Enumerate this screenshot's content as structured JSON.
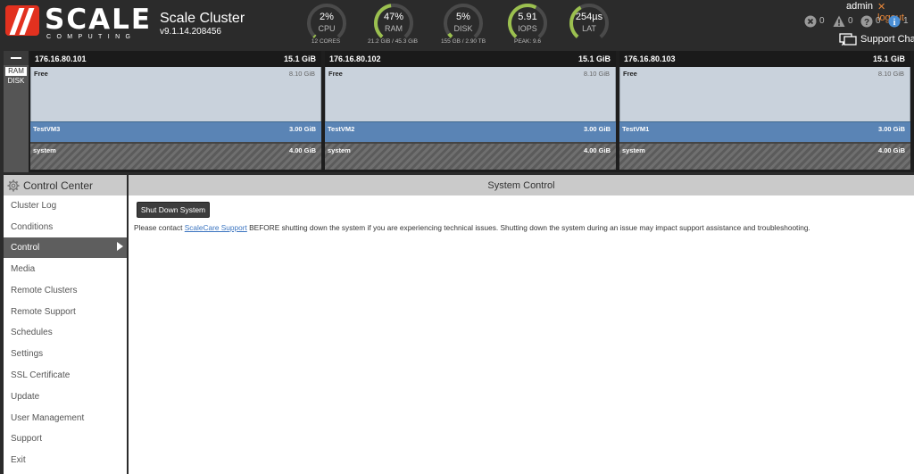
{
  "header": {
    "logo_text": "SCALE",
    "logo_subtext": "COMPUTING",
    "cluster_name": "Scale Cluster",
    "version": "v9.1.14.208456"
  },
  "gauges": [
    {
      "value": "2%",
      "label": "CPU",
      "sub": "12 CORES",
      "level": 0.02
    },
    {
      "value": "47%",
      "label": "RAM",
      "sub": "21.2 GiB / 45.3 GiB",
      "level": 0.47
    },
    {
      "value": "5%",
      "label": "DISK",
      "sub": "155 GB / 2.90 TB",
      "level": 0.05
    },
    {
      "value": "5.91",
      "label": "IOPS",
      "sub": "PEAK: 9.6",
      "level": 0.6
    },
    {
      "value": "254µs",
      "label": "LAT",
      "sub": "",
      "level": 0.4
    }
  ],
  "user": {
    "name": "admin",
    "logout_label": "logout"
  },
  "alerts": [
    {
      "icon": "error-icon",
      "count": "0"
    },
    {
      "icon": "warning-icon",
      "count": "0"
    },
    {
      "icon": "question-icon",
      "count": "0"
    },
    {
      "icon": "info-icon",
      "count": "1"
    }
  ],
  "support_chat_label": "Support Chat",
  "resource_toggle": {
    "ram": "RAM",
    "disk": "DISK"
  },
  "nodes": [
    {
      "ip": "176.16.80.101",
      "total": "15.1 GiB",
      "free_label": "Free",
      "free_size": "8.10 GiB",
      "vm_label": "TestVM3",
      "vm_size": "3.00 GiB",
      "system_label": "system",
      "system_size": "4.00 GiB"
    },
    {
      "ip": "176.16.80.102",
      "total": "15.1 GiB",
      "free_label": "Free",
      "free_size": "8.10 GiB",
      "vm_label": "TestVM2",
      "vm_size": "3.00 GiB",
      "system_label": "system",
      "system_size": "4.00 GiB"
    },
    {
      "ip": "176.16.80.103",
      "total": "15.1 GiB",
      "free_label": "Free",
      "free_size": "8.10 GiB",
      "vm_label": "TestVM1",
      "vm_size": "3.00 GiB",
      "system_label": "system",
      "system_size": "4.00 GiB"
    }
  ],
  "sidebar": {
    "title": "Control Center",
    "items": [
      {
        "label": "Cluster Log"
      },
      {
        "label": "Conditions"
      },
      {
        "label": "Control",
        "active": true
      },
      {
        "label": "Media"
      },
      {
        "label": "Remote Clusters"
      },
      {
        "label": "Remote Support"
      },
      {
        "label": "Schedules"
      },
      {
        "label": "Settings"
      },
      {
        "label": "SSL Certificate"
      },
      {
        "label": "Update"
      },
      {
        "label": "User Management"
      },
      {
        "label": "Support"
      },
      {
        "label": "Exit"
      }
    ]
  },
  "main": {
    "title": "System Control",
    "shutdown_label": "Shut Down System",
    "notice_before": "Please contact ",
    "notice_link": "ScaleCare Support",
    "notice_after": " BEFORE shutting down the system if you are experiencing technical issues. Shutting down the system during an issue may impact support assistance and troubleshooting."
  },
  "colors": {
    "accent": "#e8873a",
    "gauge_ring": "#9bc04f",
    "gauge_track": "#4a4a4a",
    "vm_bar": "#5a84b5",
    "free_bar": "#c9d2dc",
    "link": "#3a74c0"
  }
}
